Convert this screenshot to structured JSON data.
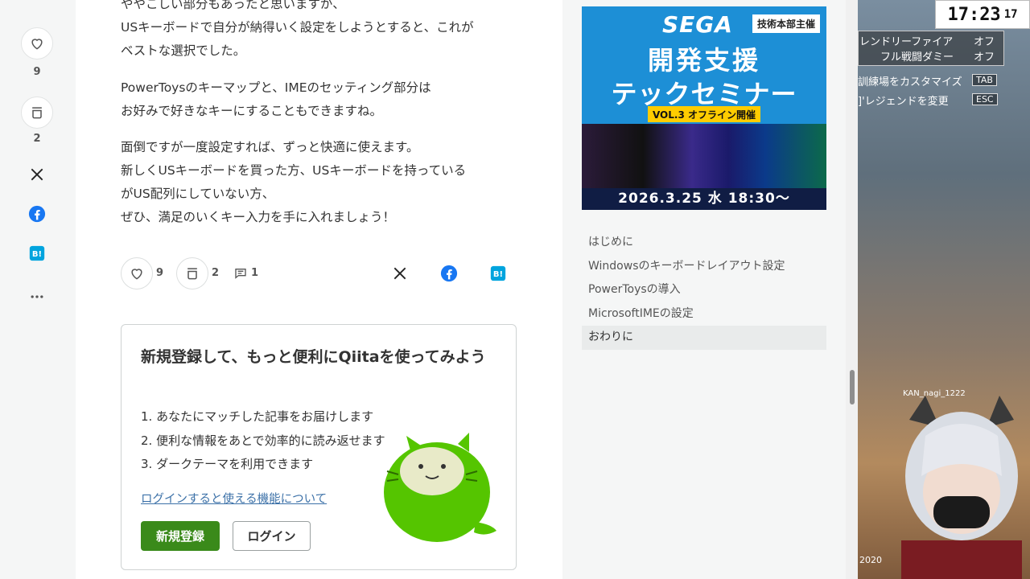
{
  "rail": {
    "like_count": "9",
    "stock_count": "2"
  },
  "article": {
    "paragraphs": [
      [
        "ややこしい部分もあったと思いますが、",
        "USキーボードで自分が納得いく設定をしようとすると、これが",
        "ベストな選択でした。"
      ],
      [
        "PowerToysのキーマップと、IMEのセッティング部分は",
        "お好みで好きなキーにすることもできますね。"
      ],
      [
        "面倒ですが一度設定すれば、ずっと快適に使えます。",
        "新しくUSキーボードを買った方、USキーボードを持っている",
        "がUS配列にしていない方、",
        "ぜひ、満足のいくキー入力を手に入れましょう！"
      ]
    ],
    "actions": {
      "like_count": "9",
      "stock_count": "2",
      "comment_count": "1"
    }
  },
  "signup": {
    "title": "新規登録して、もっと便利にQiitaを使ってみよう",
    "benefits": [
      "1. あなたにマッチした記事をお届けします",
      "2. 便利な情報をあとで効率的に読み返せます",
      "3. ダークテーマを利用できます"
    ],
    "login_features_link": "ログインすると使える機能について",
    "register_button": "新規登録",
    "login_button": "ログイン"
  },
  "ad": {
    "brand": "SEGA",
    "badge": "技術本部主催",
    "headline_1": "開発支援",
    "headline_2": "テックセミナー",
    "vol": "VOL.3 オフライン開催",
    "date": "2026.3.25 水 18:30～"
  },
  "toc": {
    "items": [
      "はじめに",
      "Windowsのキーボードレイアウト設定",
      "PowerToysの導入",
      "MicrosoftIMEの設定",
      "おわりに"
    ],
    "active_index": 4
  },
  "game": {
    "clock_main": "17:23",
    "clock_sec": "17",
    "settings": [
      {
        "label": "レンドリーファイア",
        "value": "オフ"
      },
      {
        "label": "フル戦闘ダミー",
        "value": "オフ"
      }
    ],
    "hints": [
      {
        "label": "訓練場をカスタマイズ",
        "key": "TAB"
      },
      {
        "label": "]'レジェンドを変更",
        "key": "ESC"
      }
    ],
    "player_name": "KAN_nagi_1222",
    "bottom_num": "2020"
  },
  "colors": {
    "primary_green": "#3a8a1a",
    "link_blue": "#3c71a8",
    "facebook_blue": "#1877f2",
    "hatena_blue": "#00a4de"
  }
}
